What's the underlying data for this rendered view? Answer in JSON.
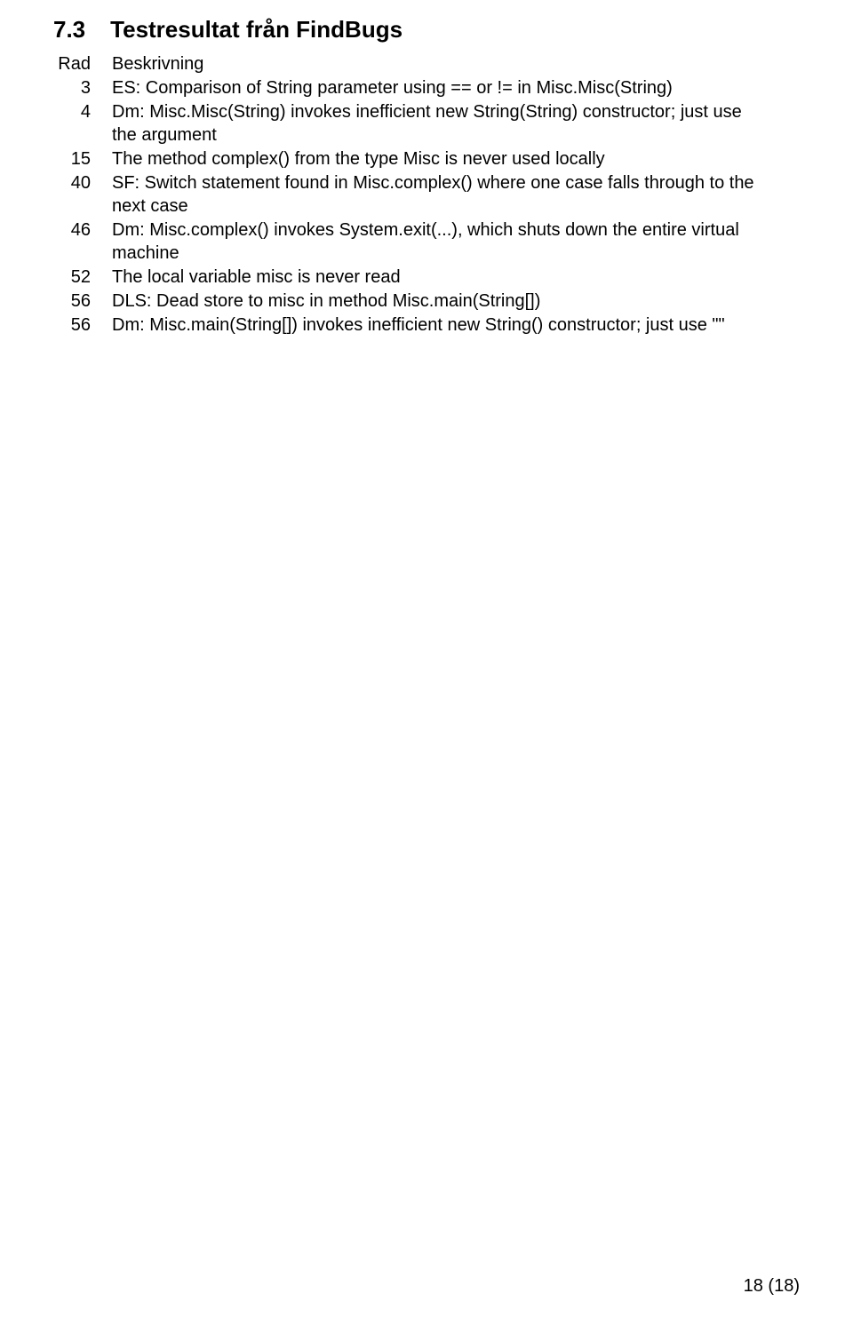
{
  "heading": {
    "number": "7.3",
    "title": "Testresultat från FindBugs"
  },
  "columns": {
    "line": "Rad",
    "desc": "Beskrivning"
  },
  "rows": [
    {
      "line": "3",
      "desc": "ES: Comparison of String parameter using == or != in Misc.Misc(String)"
    },
    {
      "line": "4",
      "desc": "Dm: Misc.Misc(String) invokes inefficient new String(String) constructor; just use the argument"
    },
    {
      "line": "15",
      "desc": "The method complex() from the type Misc is never used locally"
    },
    {
      "line": "40",
      "desc": "SF: Switch statement found in Misc.complex() where one case falls through to the next case"
    },
    {
      "line": "46",
      "desc": "Dm: Misc.complex() invokes System.exit(...), which shuts down the entire virtual machine"
    },
    {
      "line": "52",
      "desc": "The local variable misc is never read"
    },
    {
      "line": "56",
      "desc": "DLS: Dead store to misc in method Misc.main(String[])"
    },
    {
      "line": "56",
      "desc": "Dm: Misc.main(String[]) invokes inefficient new String() constructor; just use \"\""
    }
  ],
  "pageNumber": "18 (18)"
}
